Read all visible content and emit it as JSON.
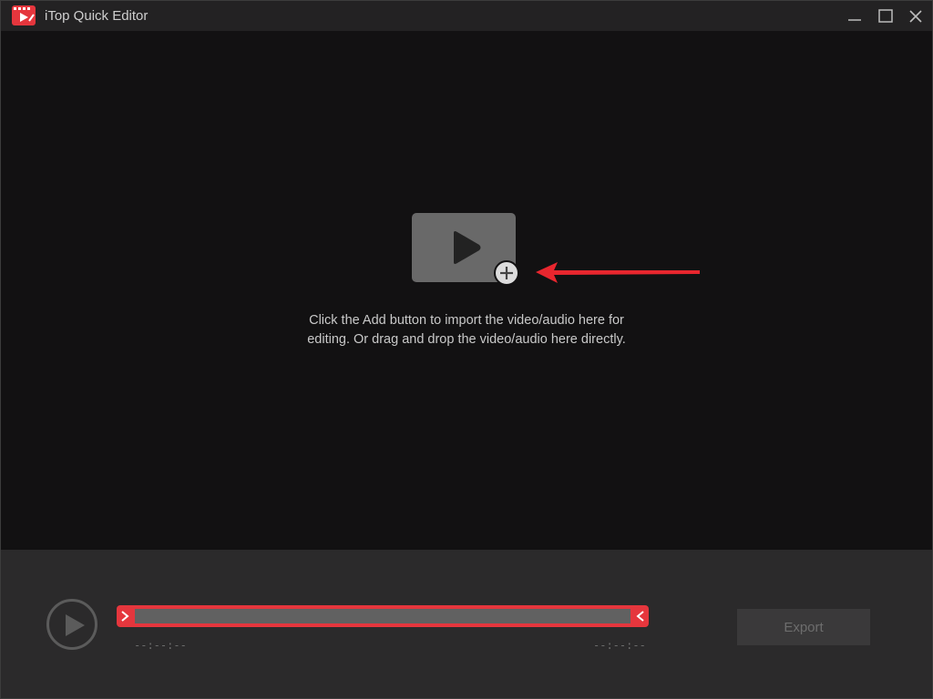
{
  "window": {
    "title": "iTop Quick Editor",
    "controls": [
      "minimize-icon",
      "maximize-icon",
      "close-icon"
    ]
  },
  "main": {
    "hint_text": "Click the Add button to import the video/audio here for editing. Or drag and drop the video/audio here directly.",
    "add_media_icon": "play-icon",
    "add_badge_icon": "plus-icon",
    "annotation": "red-arrow-pointing-left"
  },
  "timeline": {
    "play_icon": "play-icon",
    "start_time": "--:--:--",
    "end_time": "--:--:--",
    "trim_left_icon": "chevron-right-icon",
    "trim_right_icon": "chevron-left-icon"
  },
  "actions": {
    "export_label": "Export"
  },
  "colors": {
    "accent": "#e5363d",
    "background": "#121112",
    "titlebar": "#232223",
    "bottom_bar": "#2b2a2b"
  }
}
